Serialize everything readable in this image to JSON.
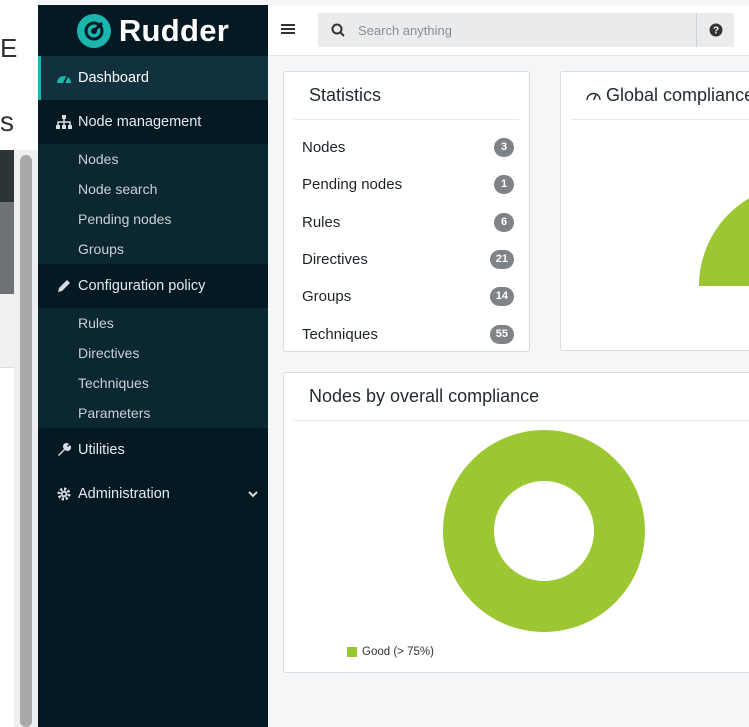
{
  "app": {
    "name": "Rudder"
  },
  "colors": {
    "accent": "#1ab5ad",
    "good": "#9bc832",
    "sidebar": "#041922"
  },
  "search": {
    "placeholder": "Search anything"
  },
  "sidebar": {
    "dashboard": "Dashboard",
    "node_management": {
      "label": "Node management",
      "items": [
        "Nodes",
        "Node search",
        "Pending nodes",
        "Groups"
      ]
    },
    "configuration_policy": {
      "label": "Configuration policy",
      "items": [
        "Rules",
        "Directives",
        "Techniques",
        "Parameters"
      ]
    },
    "utilities": "Utilities",
    "administration": "Administration"
  },
  "statistics": {
    "title": "Statistics",
    "rows": [
      {
        "label": "Nodes",
        "count": "3"
      },
      {
        "label": "Pending nodes",
        "count": "1"
      },
      {
        "label": "Rules",
        "count": "6"
      },
      {
        "label": "Directives",
        "count": "21"
      },
      {
        "label": "Groups",
        "count": "14"
      },
      {
        "label": "Techniques",
        "count": "55"
      }
    ]
  },
  "global_compliance": {
    "title": "Global compliance"
  },
  "nodes_compliance": {
    "title": "Nodes by overall compliance",
    "legend": "Good (> 75%)"
  },
  "chart_data": {
    "type": "pie",
    "categories": [
      "Good (> 75%)"
    ],
    "values": [
      3
    ],
    "title": "Nodes by overall compliance",
    "legend_placement": "bottom-left"
  }
}
